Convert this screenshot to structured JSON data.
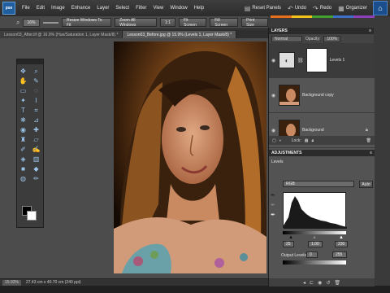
{
  "app": {
    "logo": "pse"
  },
  "menu": [
    "File",
    "Edit",
    "Image",
    "Enhance",
    "Layer",
    "Select",
    "Filter",
    "View",
    "Window",
    "Help"
  ],
  "top_buttons": [
    {
      "icon": "panels-icon",
      "glyph": "▤",
      "label": "Reset Panels"
    },
    {
      "icon": "undo-icon",
      "glyph": "↶",
      "label": "Undo"
    },
    {
      "icon": "redo-icon",
      "glyph": "↷",
      "label": "Redo"
    },
    {
      "icon": "organizer-icon",
      "glyph": "▦",
      "label": "Organizer"
    }
  ],
  "brand_colors": [
    "#e86f1c",
    "#f0c21a",
    "#45a12f",
    "#3b6fc9",
    "#8c3fb8"
  ],
  "options_bar": {
    "zoom_value": "16%",
    "resize_windows_label": "Resize Windows To Fit",
    "zoom_all_label": "Zoom All Windows",
    "ratio_label": "1:1",
    "fit_screen_label": "Fit Screen",
    "fill_screen_label": "Fill Screen",
    "print_size_label": "Print Size"
  },
  "tabs": [
    {
      "label": "Lesson03_After.tif @ 16.9% (Hue/Saturation 1, Layer Mask/8) *",
      "active": false
    },
    {
      "label": "Lesson03_Before.jpg @ 15.9% (Levels 1, Layer Mask/8) *",
      "active": true
    }
  ],
  "status": {
    "zoom": "15.93%",
    "doc_size": "27.43 cm x 40.70 cm (240 ppi)"
  },
  "layers_panel": {
    "title": "LAYERS",
    "blend_mode": "Normal",
    "opacity_label": "Opacity:",
    "opacity_value": "100%",
    "lock_label": "Lock:",
    "layers": [
      {
        "name": "Levels 1",
        "selected": true
      },
      {
        "name": "Background copy",
        "selected": false
      },
      {
        "name": "Background",
        "selected": false
      }
    ]
  },
  "adjustments_panel": {
    "title": "ADJUSTMENTS",
    "section_label": "Levels",
    "channel": "RGB",
    "auto_label": "Auto",
    "input_values": [
      "25",
      "1.00",
      "230"
    ],
    "output_label": "Output Levels:",
    "output_values": [
      "0",
      "255"
    ]
  }
}
